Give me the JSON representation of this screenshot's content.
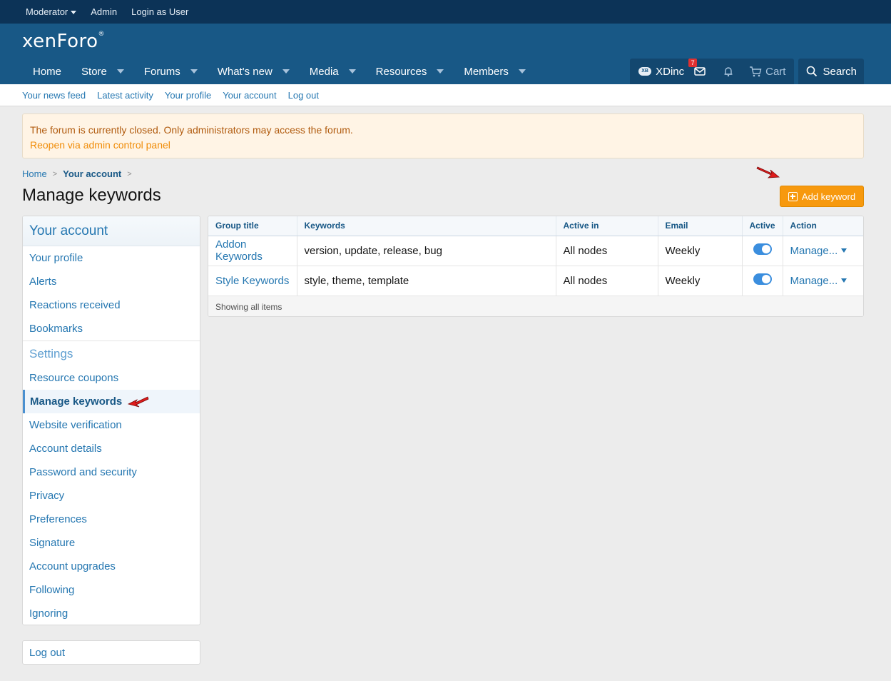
{
  "staff_bar": {
    "moderator": "Moderator",
    "admin": "Admin",
    "login_as_user": "Login as User"
  },
  "header": {
    "logo": "xenForo",
    "nav": [
      "Home",
      "Store",
      "Forums",
      "What's new",
      "Media",
      "Resources",
      "Members"
    ],
    "user": "XDinc",
    "avatar_text": "XB",
    "inbox_badge": "7",
    "cart": "Cart",
    "search": "Search"
  },
  "subnav": [
    "Your news feed",
    "Latest activity",
    "Your profile",
    "Your account",
    "Log out"
  ],
  "notice": {
    "message": "The forum is currently closed. Only administrators may access the forum.",
    "link": "Reopen via admin control panel"
  },
  "breadcrumb": [
    "Home",
    "Your account"
  ],
  "page_title": "Manage keywords",
  "add_keyword": "Add keyword",
  "sidebar": {
    "header": "Your account",
    "items_top": [
      "Your profile",
      "Alerts",
      "Reactions received",
      "Bookmarks"
    ],
    "settings_header": "Settings",
    "items_settings": [
      "Resource coupons",
      "Manage keywords",
      "Website verification",
      "Account details",
      "Password and security",
      "Privacy",
      "Preferences",
      "Signature",
      "Account upgrades",
      "Following",
      "Ignoring"
    ],
    "active_item": "Manage keywords",
    "logout": "Log out"
  },
  "table": {
    "columns": [
      "Group title",
      "Keywords",
      "Active in",
      "Email",
      "Active",
      "Action"
    ],
    "rows": [
      {
        "group": "Addon Keywords",
        "keywords": "version, update, release, bug",
        "active_in": "All nodes",
        "email": "Weekly",
        "active": true,
        "action": "Manage..."
      },
      {
        "group": "Style Keywords",
        "keywords": "style, theme, template",
        "active_in": "All nodes",
        "email": "Weekly",
        "active": true,
        "action": "Manage..."
      }
    ],
    "footer": "Showing all items"
  },
  "colors": {
    "staff_bar": "#0c3357",
    "header": "#185886",
    "accent_button": "#f7990e",
    "link": "#2577b1",
    "notice_bg": "#fff4e5"
  }
}
